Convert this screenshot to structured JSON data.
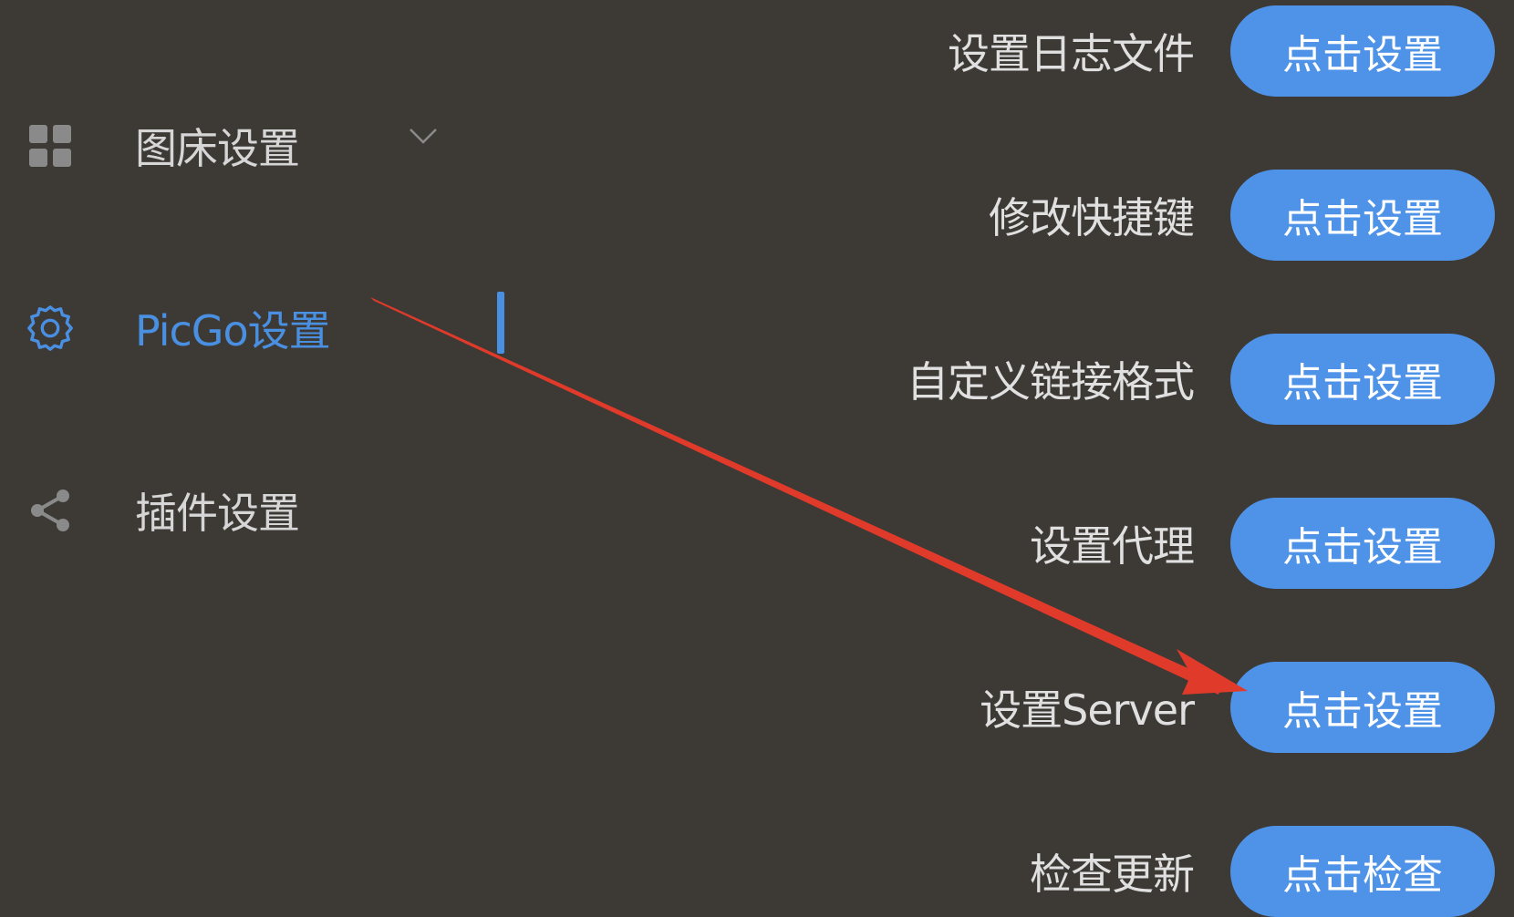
{
  "sidebar": {
    "items": [
      {
        "label": "图床设置",
        "icon": "grid-icon"
      },
      {
        "label": "PicGo设置",
        "icon": "gear-icon"
      },
      {
        "label": "插件设置",
        "icon": "share-icon"
      }
    ],
    "active_color": "#4a90e2"
  },
  "settings": {
    "rows": [
      {
        "label": "设置日志文件",
        "button": "点击设置"
      },
      {
        "label": "修改快捷键",
        "button": "点击设置"
      },
      {
        "label": "自定义链接格式",
        "button": "点击设置"
      },
      {
        "label": "设置代理",
        "button": "点击设置"
      },
      {
        "label": "设置Server",
        "button": "点击设置"
      },
      {
        "label": "检查更新",
        "button": "点击检查"
      }
    ],
    "button_color": "#4e93e7"
  },
  "annotation": {
    "color": "#e03a2a"
  }
}
